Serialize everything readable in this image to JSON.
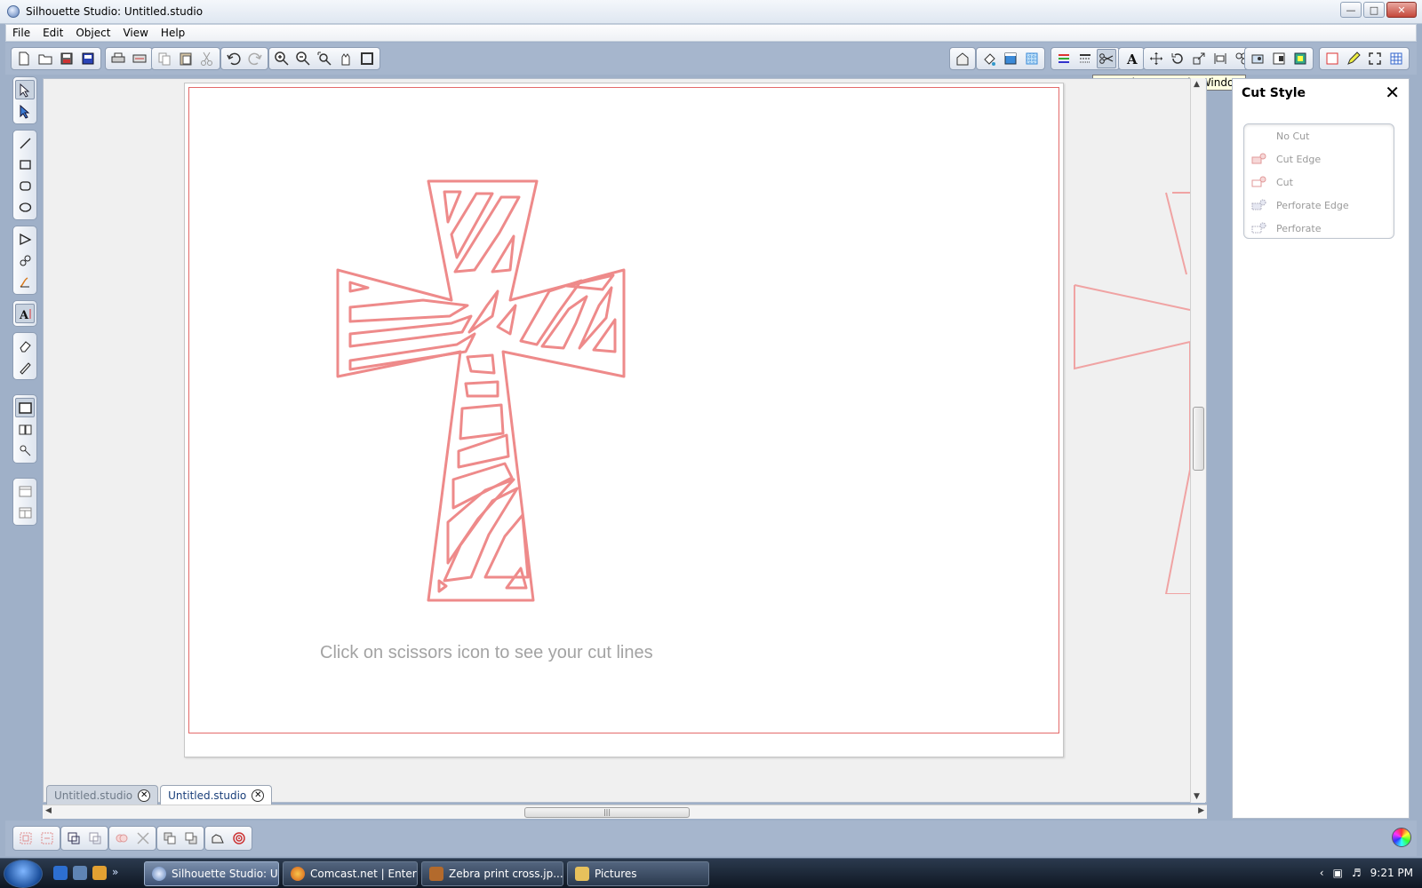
{
  "window": {
    "title": "Silhouette Studio: Untitled.studio",
    "controls": [
      "minimize",
      "maximize",
      "close"
    ]
  },
  "menu": [
    "File",
    "Edit",
    "Object",
    "View",
    "Help"
  ],
  "toolbar": {
    "tooltip": "Open the Cut Style Window",
    "active_tool": "cut-style-scissors"
  },
  "canvas": {
    "hint": "Click on scissors icon to see your cut lines",
    "cut_line_color": "#e36a6a"
  },
  "tabs": [
    {
      "label": "Untitled.studio",
      "active": false
    },
    {
      "label": "Untitled.studio",
      "active": true
    }
  ],
  "cut_style_panel": {
    "title": "Cut Style",
    "options": [
      "No Cut",
      "Cut Edge",
      "Cut",
      "Perforate Edge",
      "Perforate"
    ]
  },
  "taskbar": {
    "items": [
      {
        "label": "Silhouette Studio: U...",
        "active": true
      },
      {
        "label": "Comcast.net | Entert...",
        "active": false
      },
      {
        "label": "Zebra print cross.jp...",
        "active": false
      },
      {
        "label": "Pictures",
        "active": false
      }
    ],
    "clock": "9:21 PM"
  }
}
